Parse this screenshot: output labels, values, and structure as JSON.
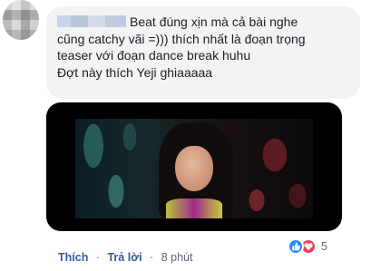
{
  "comment": {
    "lines": [
      "Beat đúng xịn mà cả bài nghe",
      "cũng catchy vãi =))) thích nhất là đoạn trọng",
      "teaser với đoạn dance break huhu",
      "Đợt này thích Yeji ghiaaaaa"
    ]
  },
  "actions": {
    "like_label": "Thích",
    "reply_label": "Trả lời",
    "separator": "·",
    "timestamp": "8 phút"
  },
  "reactions": {
    "count": "5",
    "types": [
      "like-icon",
      "love-icon"
    ],
    "like_color": "#2d88ff",
    "love_color": "#f33e58"
  },
  "colors": {
    "bubble": "#f2f3f5",
    "link": "#385898",
    "meta": "#606770"
  }
}
